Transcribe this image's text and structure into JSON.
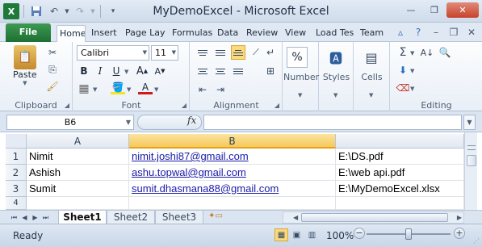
{
  "window": {
    "title": "MyDemoExcel  -  Microsoft Excel",
    "app_icon": "X"
  },
  "qat": {
    "icons": [
      "excel-app-icon",
      "save-icon",
      "undo-icon",
      "redo-icon",
      "customize-qat-icon"
    ]
  },
  "ribbon_tabs": {
    "file": "File",
    "tabs": [
      "Home",
      "Insert",
      "Page Lay",
      "Formulas",
      "Data",
      "Review",
      "View",
      "Load Tes",
      "Team"
    ],
    "active": "Home"
  },
  "ribbon": {
    "clipboard": {
      "label": "Clipboard",
      "paste": "Paste"
    },
    "font": {
      "label": "Font",
      "name": "Calibri",
      "size": "11"
    },
    "alignment": {
      "label": "Alignment"
    },
    "number": {
      "label": "Number",
      "symbol": "%"
    },
    "styles": {
      "label": "Styles"
    },
    "cells": {
      "label": "Cells"
    },
    "editing": {
      "label": "Editing"
    }
  },
  "formula_bar": {
    "name_box": "B6",
    "fx": "fx",
    "value": ""
  },
  "sheet": {
    "columns": [
      "A",
      "B"
    ],
    "selected_column": "B",
    "rows": [
      {
        "num": "1",
        "a": "Nimit",
        "b": "nimit.joshi87@gmail.com",
        "c": "E:\\DS.pdf"
      },
      {
        "num": "2",
        "a": "Ashish",
        "b": "ashu.topwal@gmail.com",
        "c": "E:\\web api.pdf"
      },
      {
        "num": "3",
        "a": "Sumit",
        "b": "sumit.dhasmana88@gmail.com",
        "c": "E:\\MyDemoExcel.xlsx"
      },
      {
        "num": "4",
        "a": "",
        "b": "",
        "c": ""
      }
    ]
  },
  "sheet_tabs": [
    "Sheet1",
    "Sheet2",
    "Sheet3"
  ],
  "active_sheet": "Sheet1",
  "status": {
    "text": "Ready",
    "zoom": "100%",
    "zoom_value_percent": 100
  }
}
